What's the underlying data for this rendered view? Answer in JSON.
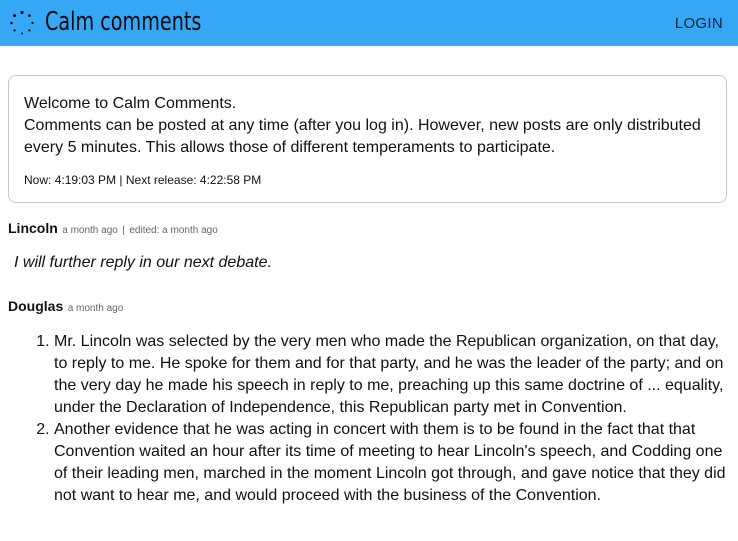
{
  "header": {
    "title": "Calm comments",
    "login_label": "LOGIN",
    "background_color": "#35a7f5",
    "logo_icon": "dotted-circle-logo-icon"
  },
  "welcome": {
    "line1": "Welcome to Calm Comments.",
    "line2": "Comments can be posted at any time (after you log in). However, new posts are only distributed every 5 minutes. This allows those of different temperaments to participate.",
    "now_label": "Now:",
    "now_value": "4:19:03 PM",
    "separator": "|",
    "next_label": "Next release:",
    "next_value": "4:22:58 PM"
  },
  "comments": [
    {
      "author": "Lincoln",
      "time": "a month ago",
      "separator": "|",
      "edited": "edited: a month ago",
      "text": "I will further reply in our next debate."
    },
    {
      "author": "Douglas",
      "time": "a month ago",
      "points": [
        "Mr. Lincoln was selected by the very men who made the Republican organization, on that day, to reply to me. He spoke for them and for that party, and he was the leader of the party; and on the very day he made his speech in reply to me, preaching up this same doctrine of ... equality, under the Declaration of Independence, this Republican party met in Convention.",
        "Another evidence that he was acting in concert with them is to be found in the fact that that Convention waited an hour after its time of meeting to hear Lincoln's speech, and Codding one of their leading men, marched in the moment Lincoln got through, and gave notice that they did not want to hear me, and would proceed with the business of the Convention."
      ]
    }
  ]
}
